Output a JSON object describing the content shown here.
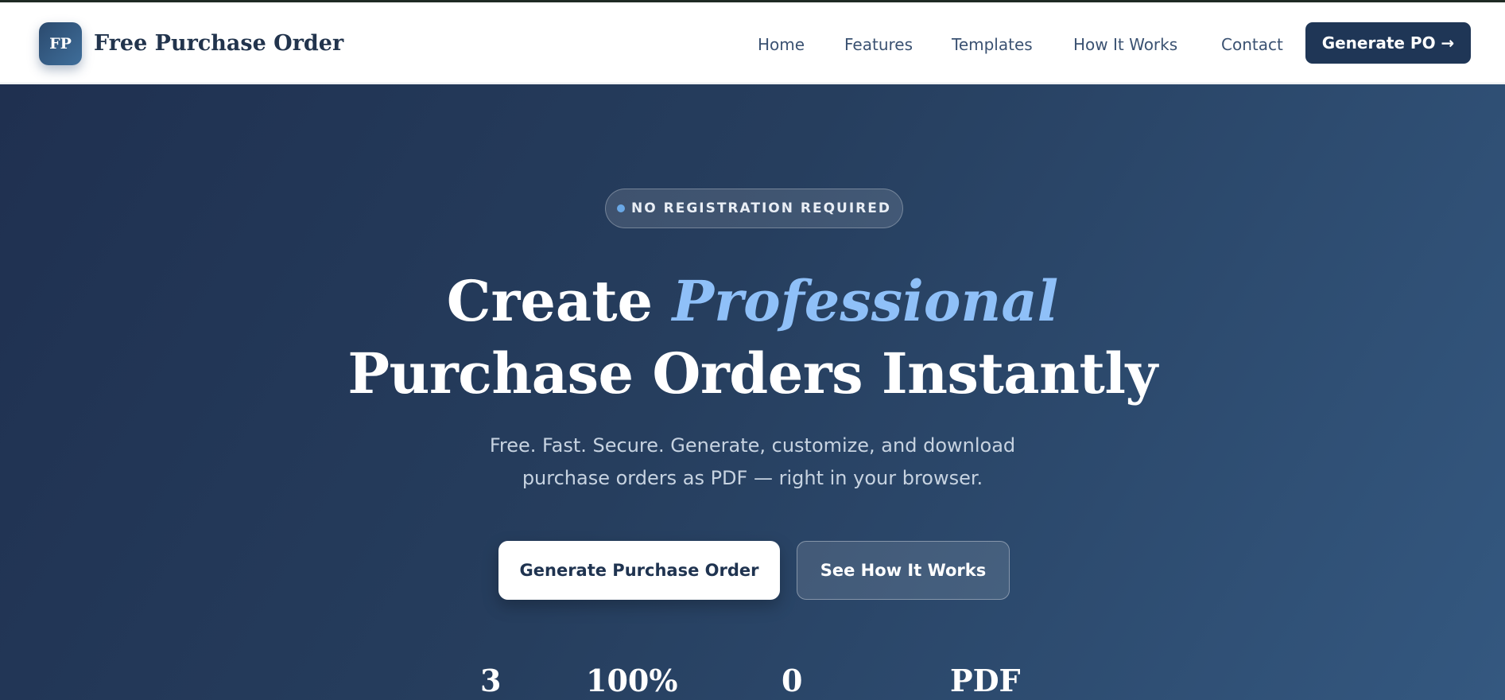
{
  "header": {
    "logo_initials": "FP",
    "brand_name": "Free Purchase Order",
    "nav": [
      "Home",
      "Features",
      "Templates",
      "How It Works",
      "Contact"
    ],
    "cta_label": "Generate PO →"
  },
  "hero": {
    "badge": "NO REGISTRATION REQUIRED",
    "headline_part1": "Create ",
    "headline_accent": "Professional",
    "headline_line2": "Purchase Orders Instantly",
    "subtext_line1": "Free. Fast. Secure. Generate, customize, and download",
    "subtext_line2": "purchase orders as PDF — right in your browser.",
    "primary_button": "Generate Purchase Order",
    "secondary_button": "See How It Works",
    "stats": [
      "3",
      "100%",
      "0",
      "PDF"
    ]
  },
  "colors": {
    "primary_dark": "#1f3656",
    "accent_blue": "#8fc0f8",
    "hero_gradient_start": "#1f3050",
    "hero_gradient_end": "#345880"
  }
}
